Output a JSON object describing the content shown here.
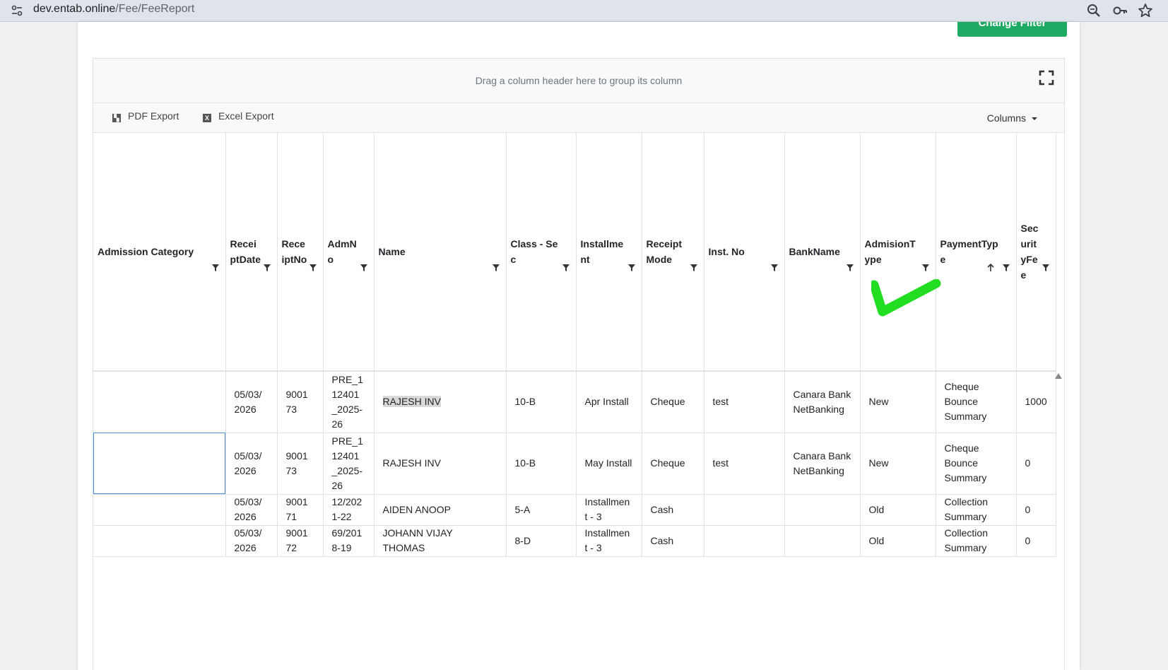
{
  "browser": {
    "url_host": "dev.entab.online",
    "url_path": "/Fee/FeeReport"
  },
  "page": {
    "change_filter_label": "Change Filter"
  },
  "grid": {
    "group_hint": "Drag a column header here to group its column",
    "pdf_export": "PDF Export",
    "excel_export": "Excel Export",
    "columns_label": "Columns",
    "headers": [
      "Admission Category",
      "ReceiptDate",
      "ReceiptNo",
      "AdmNo",
      "Name",
      "Class - Sec",
      "Installment",
      "ReceiptMode",
      "Inst. No",
      "BankName",
      "AdmisionType",
      "PaymentType",
      "SecurityFee"
    ],
    "rows": [
      [
        "",
        "05/03/ 2026",
        "9001 73",
        "PRE_1 12401 _2025- 26",
        "RAJESH INV",
        "10-B",
        "Apr Install",
        "Cheque",
        "test",
        "Canara Bank NetBanking",
        "New",
        "Cheque Bounce Summary",
        "1000"
      ],
      [
        "",
        "05/03/ 2026",
        "9001 73",
        "PRE_1 12401 _2025- 26",
        "RAJESH INV",
        "10-B",
        "May Install",
        "Cheque",
        "test",
        "Canara Bank NetBanking",
        "New",
        "Cheque Bounce Summary",
        "0"
      ],
      [
        "",
        "05/03/ 2026",
        "9001 71",
        "12/202 1-22",
        "AIDEN ANOOP",
        "5-A",
        "Installmen t - 3",
        "Cash",
        "",
        "",
        "Old",
        "Collection Summary",
        "0"
      ],
      [
        "",
        "05/03/ 2026",
        "9001 72",
        "69/201 8-19",
        "JOHANN VIJAY THOMAS",
        "8-D",
        "Installmen t - 3",
        "Cash",
        "",
        "",
        "Old",
        "Collection Summary",
        "0"
      ]
    ]
  },
  "colors": {
    "accent": "#1faa63",
    "checkmark": "#22dd22"
  }
}
